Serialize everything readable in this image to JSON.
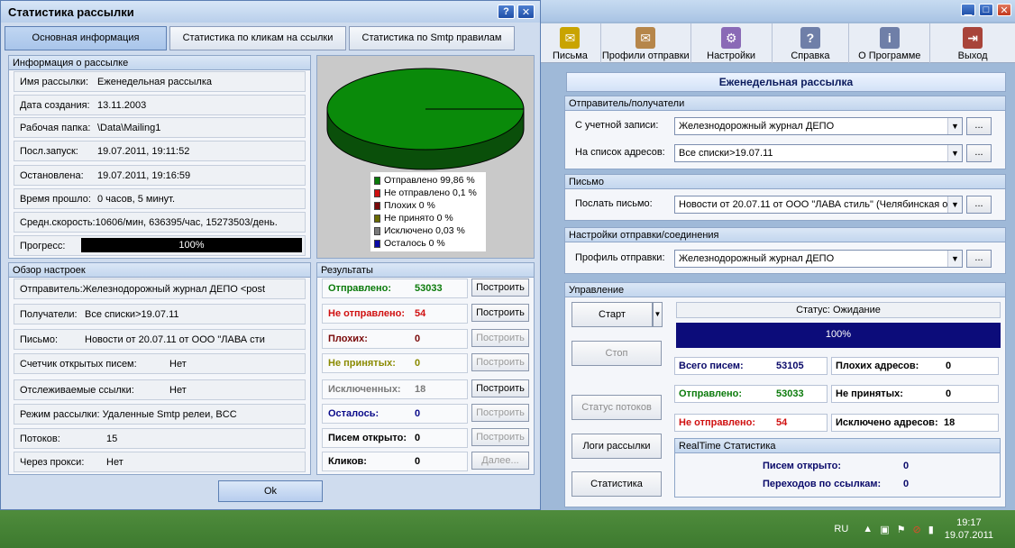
{
  "dialog": {
    "title": "Статистика рассылки",
    "tabs": [
      "Основная информация",
      "Статистика по кликам на ссылки",
      "Статистика по Smtp правилам"
    ],
    "info_group": "Информация о рассылке",
    "info": [
      {
        "label": "Имя рассылки:",
        "value": "Еженедельная рассылка"
      },
      {
        "label": "Дата создания:",
        "value": "13.11.2003"
      },
      {
        "label": "Рабочая папка:",
        "value": "\\Data\\Mailing1"
      },
      {
        "label": "Посл.запуск:",
        "value": "19.07.2011, 19:11:52"
      },
      {
        "label": "Остановлена:",
        "value": "19.07.2011, 19:16:59"
      },
      {
        "label": "Время прошло:",
        "value": "0 часов, 5 минут."
      },
      {
        "label": "Средн.скорость:",
        "value": "10606/мин, 636395/час, 15273503/день."
      }
    ],
    "progress_label": "Прогресс:",
    "progress_text": "100%",
    "progress_value": 100,
    "legend": [
      {
        "text": "Отправлено 99,86 %",
        "color": "#0a7a0a"
      },
      {
        "text": "Не отправлено 0,1 %",
        "color": "#d01010"
      },
      {
        "text": "Плохих 0 %",
        "color": "#7a0a0a"
      },
      {
        "text": "Не принято 0 %",
        "color": "#6b6b00"
      },
      {
        "text": "Исключено 0,03 %",
        "color": "#7a7a7a"
      },
      {
        "text": "Осталось 0 %",
        "color": "#0a0aa8"
      }
    ],
    "settings_group": "Обзор настроек",
    "settings": [
      {
        "label": "Отправитель:",
        "value": "Железнодорожный журнал ДЕПО <post"
      },
      {
        "label": "Получатели:",
        "value": "Все списки>19.07.11"
      },
      {
        "label": "Письмо:",
        "value": "Новости от 20.07.11 от ООО \"ЛАВА сти"
      },
      {
        "label": "Счетчик открытых писем:",
        "value": "Нет"
      },
      {
        "label": "Отслеживаемые ссылки:",
        "value": "Нет"
      },
      {
        "label": "Режим рассылки:",
        "value": "Удаленные Smtp релеи, BCC"
      },
      {
        "label": "Потоков:",
        "value": "15"
      },
      {
        "label": "Через прокси:",
        "value": "Нет"
      }
    ],
    "results_group": "Результаты",
    "results": [
      {
        "label": "Отправлено:",
        "value": "53033",
        "color": "#0a7a0a",
        "btn": "Построить",
        "enabled": true
      },
      {
        "label": "Не отправлено:",
        "value": "54",
        "color": "#d01010",
        "btn": "Построить",
        "enabled": true
      },
      {
        "label": "Плохих:",
        "value": "0",
        "color": "#7a0a0a",
        "btn": "Построить",
        "enabled": false
      },
      {
        "label": "Не принятых:",
        "value": "0",
        "color": "#8a8a00",
        "btn": "Построить",
        "enabled": false
      },
      {
        "label": "Исключенных:",
        "value": "18",
        "color": "#7a7a7a",
        "btn": "Построить",
        "enabled": true
      },
      {
        "label": "Осталось:",
        "value": "0",
        "color": "#0a0a8a",
        "btn": "Построить",
        "enabled": false
      },
      {
        "label": "Писем открыто:",
        "value": "0",
        "color": "#000000",
        "btn": "Построить",
        "enabled": false
      },
      {
        "label": "Кликов:",
        "value": "0",
        "color": "#000000",
        "btn": "Далее...",
        "enabled": false
      }
    ],
    "ok_label": "Ok",
    "help_label": "?",
    "close_label": "✕"
  },
  "main": {
    "toolbar": [
      "Письма",
      "Профили отправки",
      "Настройки",
      "Справка",
      "О Программе",
      "Выход"
    ],
    "header": "Еженедельная рассылка",
    "sender_group": "Отправитель/получатели",
    "account_label": "С учетной записи:",
    "account_value": "Железнодорожный журнал ДЕПО",
    "list_label": "На список адресов:",
    "list_value": "Все списки>19.07.11",
    "letter_group": "Письмо",
    "send_label": "Послать письмо:",
    "send_value": "Новости от 20.07.11 от ООО \"ЛАВА стиль\" (Челябинская о",
    "conn_group": "Настройки отправки/соединения",
    "profile_label": "Профиль отправки:",
    "profile_value": "Железнодорожный журнал ДЕПО",
    "dots": "...",
    "control_group": "Управление",
    "start": "Старт",
    "stop": "Стоп",
    "threads": "Статус потоков",
    "logs": "Логи рассылки",
    "stats": "Статистика",
    "status": "Статус: Ожидание",
    "progress": "100%",
    "total_label": "Всего писем:",
    "total_value": "53105",
    "bad_label": "Плохих адресов:",
    "bad_value": "0",
    "sent_label": "Отправлено:",
    "sent_value": "53033",
    "notacc_label": "Не принятых:",
    "notacc_value": "0",
    "notsent_label": "Не отправлено:",
    "notsent_value": "54",
    "excl_label": "Исключено адресов:",
    "excl_value": "18",
    "rt_group": "RealTime Статистика",
    "opened_label": "Писем открыто:",
    "opened_value": "0",
    "clicks_label": "Переходов по ссылкам:",
    "clicks_value": "0"
  },
  "taskbar": {
    "lang": "RU",
    "time": "19:17",
    "date": "19.07.2011"
  }
}
